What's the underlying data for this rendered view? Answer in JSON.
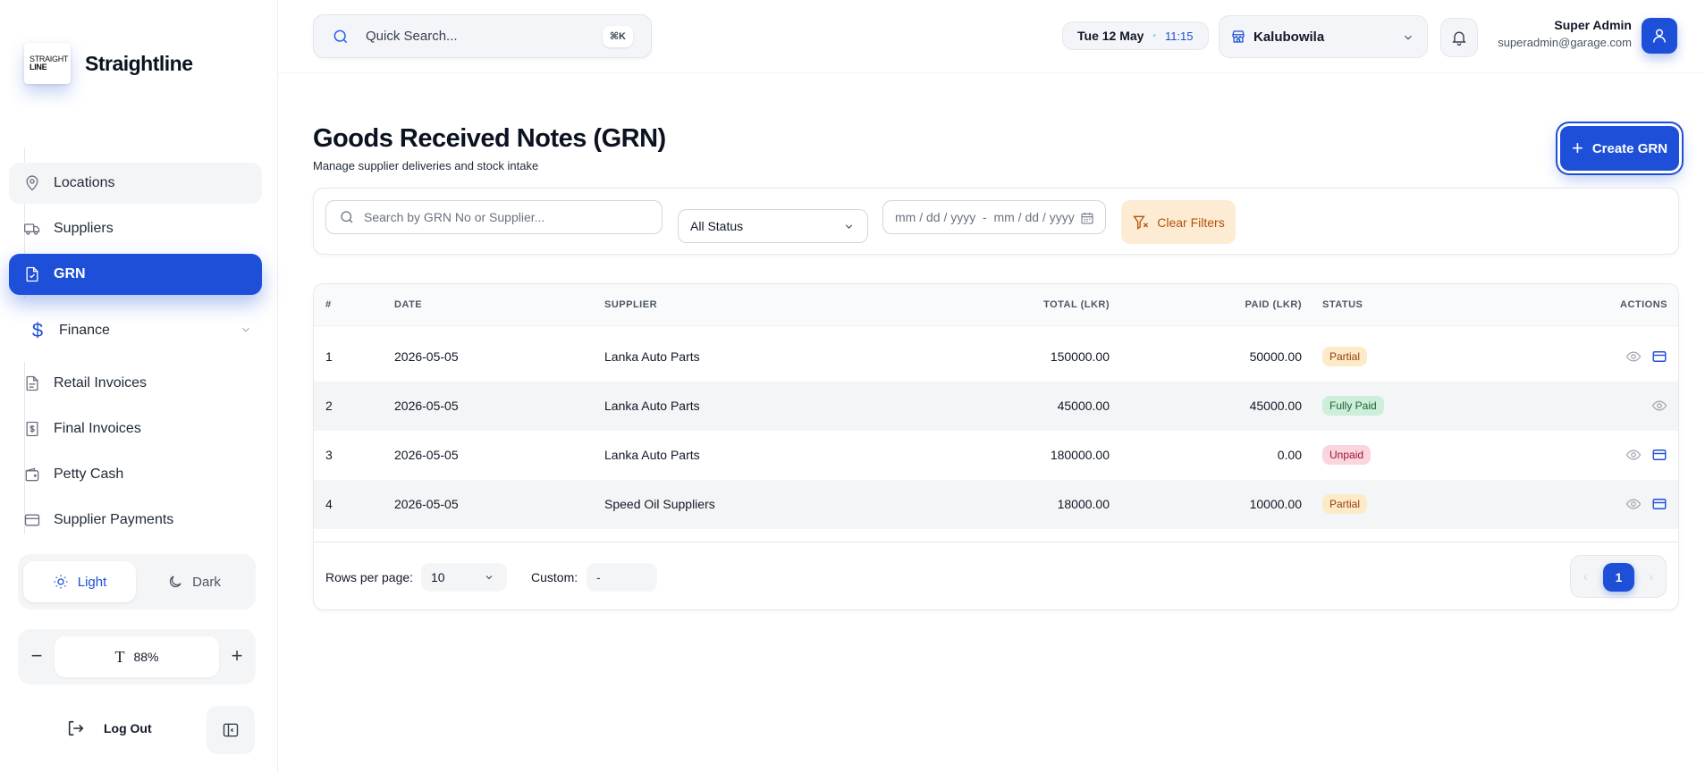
{
  "brand": {
    "logo_line1": "STRAIGHT",
    "logo_line2": "LINE",
    "name": "Straightline"
  },
  "sidebar": {
    "items": [
      {
        "label": "Locations",
        "icon": "map-pin-icon"
      },
      {
        "label": "Suppliers",
        "icon": "truck-icon"
      },
      {
        "label": "GRN",
        "icon": "file-check-icon",
        "active": true
      }
    ],
    "finance": {
      "label": "Finance",
      "icon": "dollar-icon",
      "items": [
        {
          "label": "Retail Invoices",
          "icon": "file-text-icon"
        },
        {
          "label": "Final Invoices",
          "icon": "file-dollar-icon"
        },
        {
          "label": "Petty Cash",
          "icon": "wallet-icon"
        },
        {
          "label": "Supplier Payments",
          "icon": "credit-card-icon"
        }
      ]
    },
    "theme": {
      "light": "Light",
      "dark": "Dark",
      "selected": "Light"
    },
    "zoom": {
      "value": "88%"
    },
    "logout_label": "Log Out"
  },
  "topbar": {
    "search_placeholder": "Quick Search...",
    "shortcut": "⌘K",
    "date": "Tue 12 May",
    "time": "11:15",
    "location": "Kalubowila",
    "user_name": "Super Admin",
    "user_email": "superadmin@garage.com"
  },
  "page": {
    "title": "Goods Received Notes (GRN)",
    "subtitle": "Manage supplier deliveries and stock intake",
    "create_label": "Create GRN"
  },
  "filters": {
    "search_placeholder": "Search by GRN No or Supplier...",
    "status": "All Status",
    "date_range": "mm / dd / yyyy  -  mm / dd / yyyy",
    "clear_label": "Clear Filters"
  },
  "table": {
    "columns": {
      "num": "#",
      "date": "DATE",
      "supplier": "SUPPLIER",
      "total": "TOTAL (LKR)",
      "paid": "PAID (LKR)",
      "status": "STATUS",
      "actions": "ACTIONS"
    },
    "rows": [
      {
        "num": "1",
        "date": "2026-05-05",
        "supplier": "Lanka Auto Parts",
        "total": "150000.00",
        "paid": "50000.00",
        "status": "Partial"
      },
      {
        "num": "2",
        "date": "2026-05-05",
        "supplier": "Lanka Auto Parts",
        "total": "45000.00",
        "paid": "45000.00",
        "status": "Fully Paid"
      },
      {
        "num": "3",
        "date": "2026-05-05",
        "supplier": "Lanka Auto Parts",
        "total": "180000.00",
        "paid": "0.00",
        "status": "Unpaid"
      },
      {
        "num": "4",
        "date": "2026-05-05",
        "supplier": "Speed Oil Suppliers",
        "total": "18000.00",
        "paid": "10000.00",
        "status": "Partial"
      }
    ]
  },
  "pagination": {
    "rows_label": "Rows per page:",
    "rows_value": "10",
    "custom_label": "Custom:",
    "custom_value": "-",
    "current_page": "1",
    "prev": "‹",
    "next": "›"
  }
}
